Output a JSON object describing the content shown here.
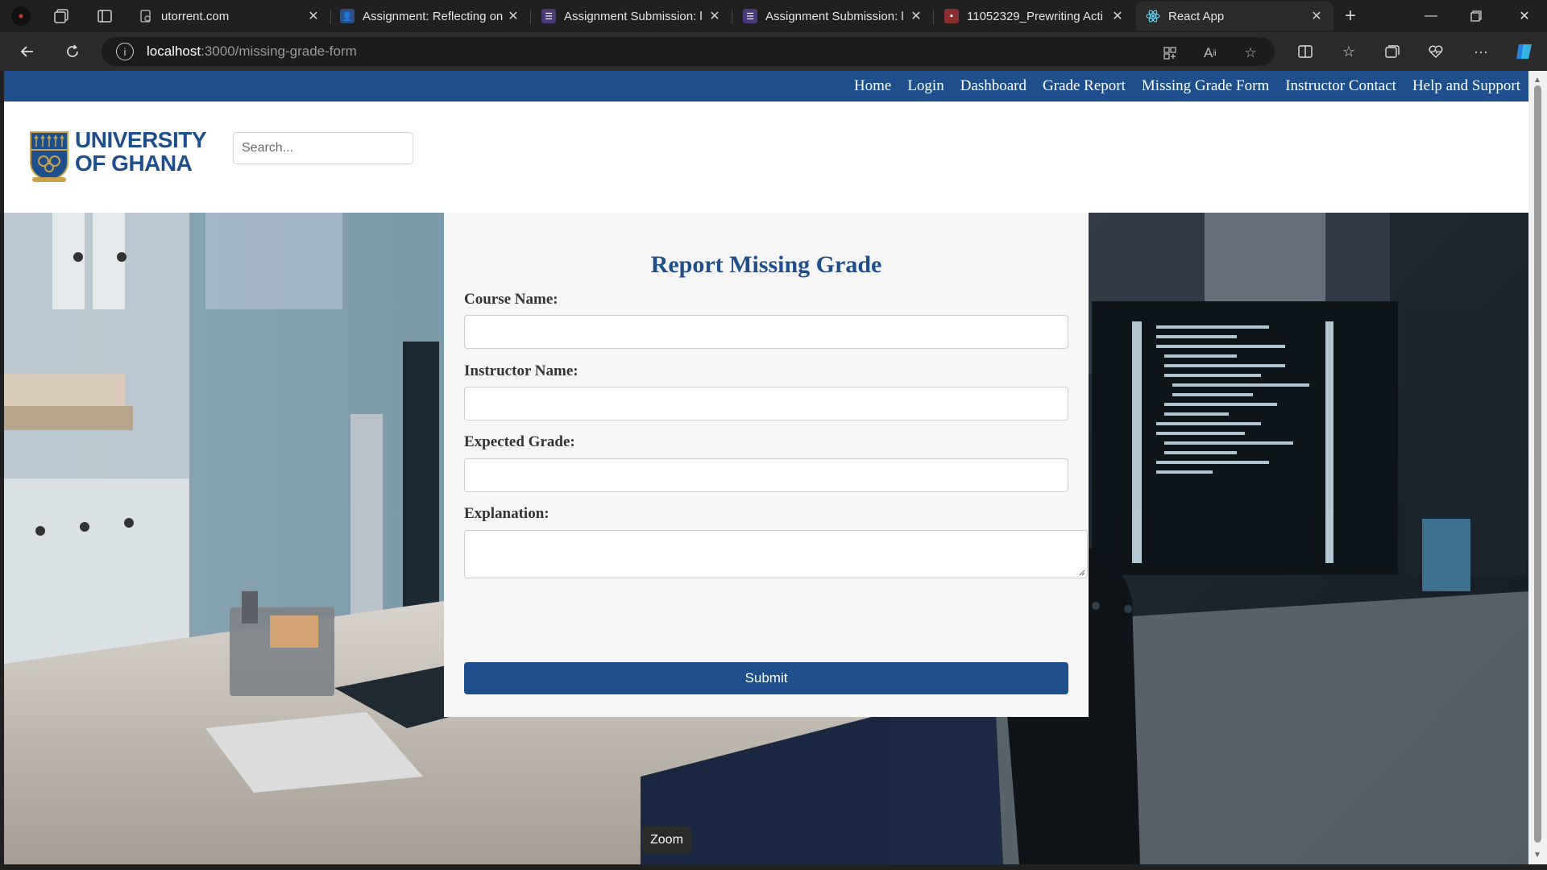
{
  "browser": {
    "tabs": [
      {
        "title": "utorrent.com",
        "icon": "page-icon",
        "active": false
      },
      {
        "title": "Assignment: Reflecting on",
        "icon": "assignment-icon",
        "active": false
      },
      {
        "title": "Assignment Submission: l",
        "icon": "list-icon",
        "active": false
      },
      {
        "title": "Assignment Submission: l",
        "icon": "list-icon",
        "active": false
      },
      {
        "title": "11052329_Prewriting Acti",
        "icon": "pdf-icon",
        "active": false
      },
      {
        "title": "React App",
        "icon": "react-icon",
        "active": true
      }
    ],
    "url_host": "localhost",
    "url_path": ":3000/missing-grade-form",
    "colors": {
      "tabbar": "#202020",
      "toolbar": "#2b2b2b"
    }
  },
  "site": {
    "nav": [
      "Home",
      "Login",
      "Dashboard",
      "Grade Report",
      "Missing Grade Form",
      "Instructor Contact",
      "Help and Support"
    ],
    "logo_line1": "UNIVERSITY",
    "logo_line2": "OF GHANA",
    "search_placeholder": "Search...",
    "brand_color": "#1e4f8c"
  },
  "form": {
    "title": "Report Missing Grade",
    "fields": [
      {
        "label": "Course Name:",
        "value": ""
      },
      {
        "label": "Instructor Name:",
        "value": ""
      },
      {
        "label": "Expected Grade:",
        "value": ""
      },
      {
        "label": "Explanation:",
        "value": ""
      }
    ],
    "submit_label": "Submit"
  },
  "tooltip": "Zoom"
}
